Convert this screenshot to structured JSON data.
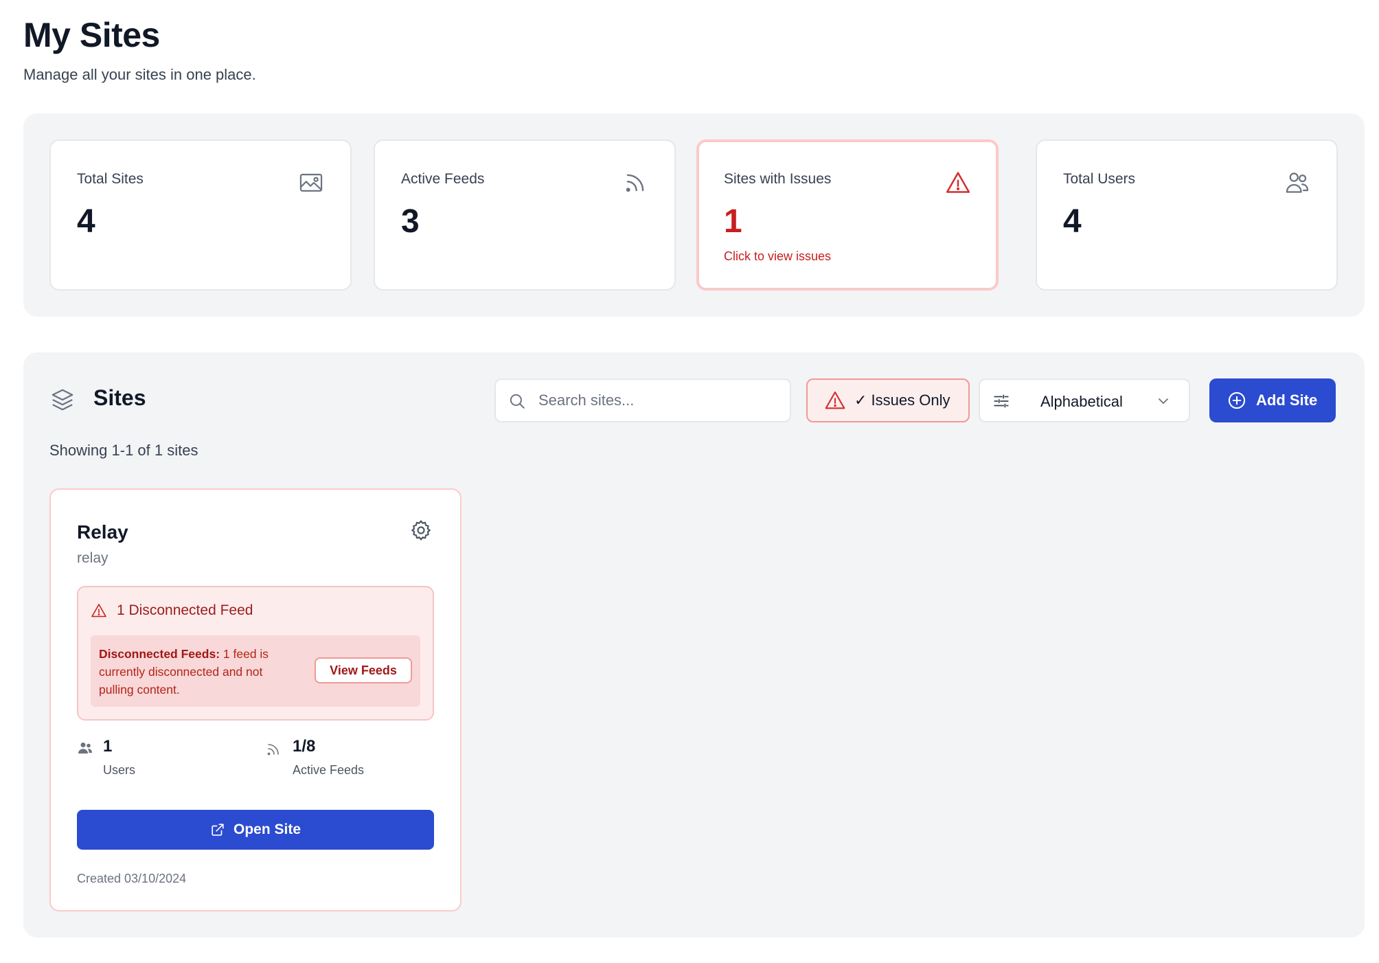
{
  "header": {
    "title": "My Sites",
    "subtitle": "Manage all your sites in one place."
  },
  "stats": {
    "total_sites": {
      "label": "Total Sites",
      "value": "4",
      "icon": "image-icon"
    },
    "active_feeds": {
      "label": "Active Feeds",
      "value": "3",
      "icon": "rss-icon"
    },
    "sites_with_issues": {
      "label": "Sites with Issues",
      "value": "1",
      "link": "Click to view issues",
      "icon": "warning-icon"
    },
    "total_users": {
      "label": "Total Users",
      "value": "4",
      "icon": "users-icon"
    }
  },
  "sites_section": {
    "heading": "Sites",
    "search_placeholder": "Search sites...",
    "issues_filter_label": "✓ Issues Only",
    "sort_value": "Alphabetical",
    "add_button_label": "Add Site",
    "showing_text": "Showing 1-1 of 1 sites"
  },
  "site_cards": [
    {
      "name": "Relay",
      "slug": "relay",
      "alert_title": "1 Disconnected Feed",
      "alert_bold": "Disconnected Feeds:",
      "alert_text": " 1 feed is currently disconnected and not pulling content.",
      "view_feeds_label": "View Feeds",
      "users_value": "1",
      "users_label": "Users",
      "feeds_value": "1/8",
      "feeds_label": "Active Feeds",
      "open_label": "Open Site",
      "created": "Created 03/10/2024"
    }
  ],
  "colors": {
    "primary": "#2b4bd0",
    "danger": "#c81e1e",
    "panel_bg": "#f3f4f6"
  }
}
